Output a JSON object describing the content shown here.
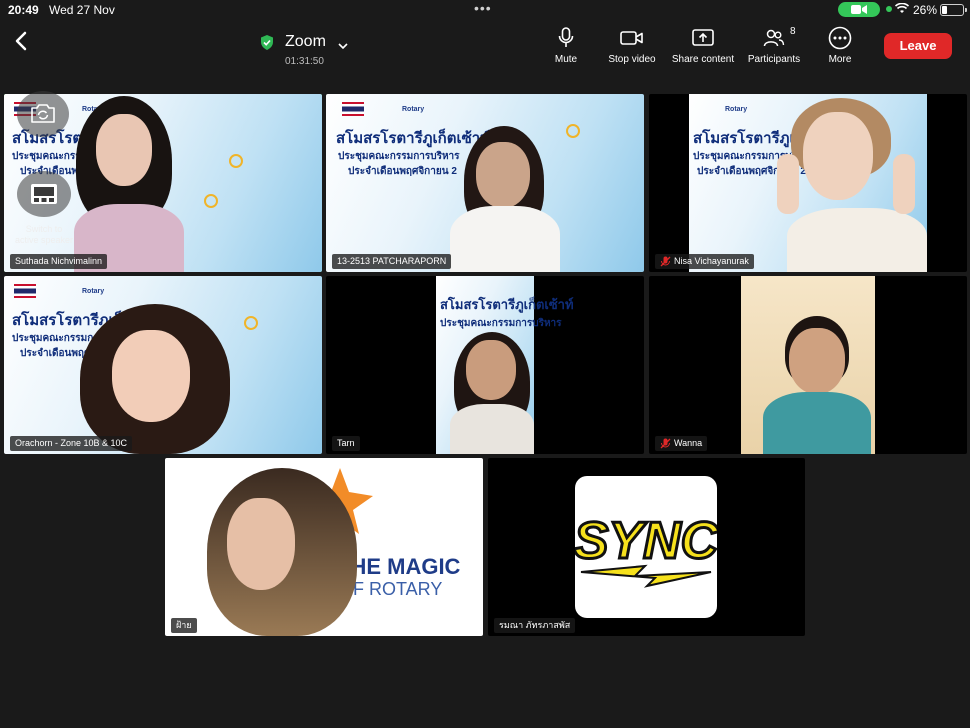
{
  "status_bar": {
    "time": "20:49",
    "date": "Wed 27 Nov",
    "battery_percent": "26%",
    "battery_level": 0.26
  },
  "toolbar": {
    "meeting_title": "Zoom",
    "timer": "01:31:50",
    "mute_label": "Mute",
    "stop_video_label": "Stop video",
    "share_label": "Share content",
    "participants_label": "Participants",
    "participants_count": "8",
    "more_label": "More",
    "leave_label": "Leave"
  },
  "banner": {
    "rotary": "Rotary",
    "line1": "สโมสรโรตารีภูเก็ตเซ้าท์",
    "line2": "ประชุมคณะกรรมการบริหาร",
    "line3": "ประจำเดือนพฤศจิกายน 2"
  },
  "overlay": {
    "switch_label_1": "Switch to",
    "switch_label_2": "active speaker"
  },
  "magic_logo": {
    "line1": "THE MAGIC",
    "line2": "OF ROTARY"
  },
  "sync_logo": {
    "text": "SYNC"
  },
  "participants": [
    {
      "name": "Suthada Nichvimalinn",
      "muted": false,
      "active": true
    },
    {
      "name": "13-2513 PATCHARAPORN",
      "muted": false,
      "active": false
    },
    {
      "name": "Nisa  Vichayanurak",
      "muted": true,
      "active": false
    },
    {
      "name": "Orachorn - Zone 10B & 10C",
      "muted": false,
      "active": false
    },
    {
      "name": "Tarn",
      "muted": false,
      "active": false
    },
    {
      "name": "Wanna",
      "muted": true,
      "active": false
    },
    {
      "name": "ฝ้าย",
      "muted": false,
      "active": false
    },
    {
      "name": "รมณา ภัทรภาสพัส",
      "muted": false,
      "active": false
    }
  ],
  "colors": {
    "background": "#1a1a1a",
    "leave": "#e02828",
    "active_speaker": "#5ee05e",
    "muted_icon": "#e02828",
    "shield": "#2fb855"
  }
}
